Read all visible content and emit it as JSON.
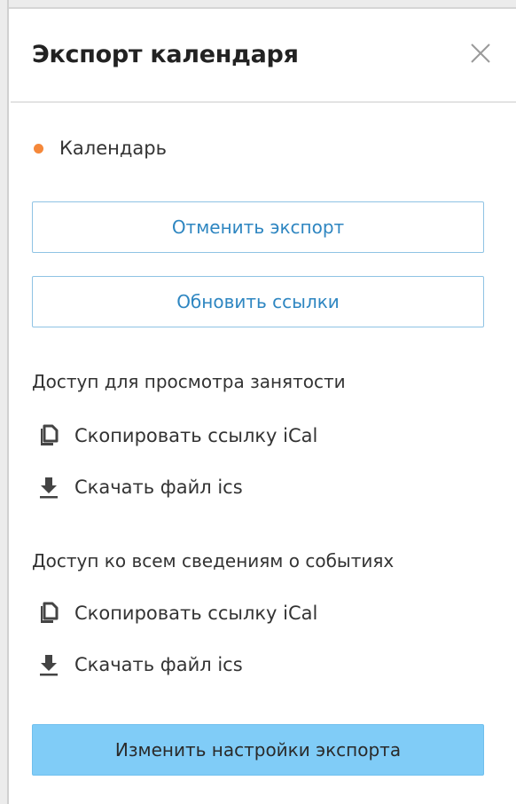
{
  "header": {
    "title": "Экспорт календаря"
  },
  "calendar": {
    "name": "Календарь",
    "dot_color": "#f5883a"
  },
  "buttons": {
    "cancel_export": "Отменить экспорт",
    "refresh_links": "Обновить ссылки",
    "change_settings": "Изменить настройки экспорта"
  },
  "sections": [
    {
      "heading": "Доступ для просмотра занятости",
      "copy_link": "Скопировать ссылку iCal",
      "download": "Скачать файл ics"
    },
    {
      "heading": "Доступ ко всем сведениям о событиях",
      "copy_link": "Скопировать ссылку iCal",
      "download": "Скачать файл ics"
    }
  ],
  "colors": {
    "accent": "#2e86c1",
    "primary_button_bg": "#80ccf7",
    "outline_border": "#8fc3e4"
  },
  "icons": {
    "close": "close-icon",
    "copy": "copy-icon",
    "download": "download-icon"
  }
}
